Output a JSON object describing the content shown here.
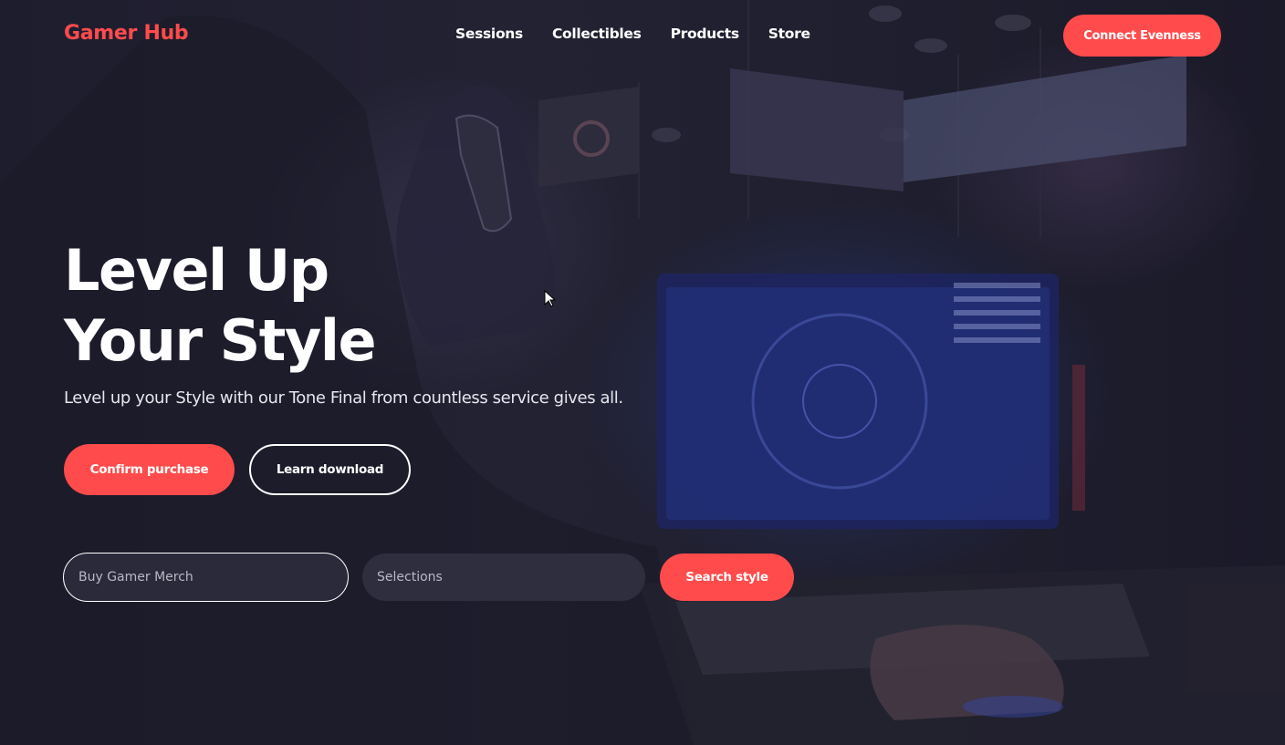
{
  "header": {
    "logo": "Gamer Hub",
    "nav": [
      "Sessions",
      "Collectibles",
      "Products",
      "Store"
    ],
    "cta_label": "Connect Evenness"
  },
  "hero": {
    "title_line1": "Level Up",
    "title_line2": "Your Style",
    "subtitle": "Level up your Style with our Tone Final from countless service gives all.",
    "primary_button": "Confirm purchase",
    "secondary_button": "Learn download"
  },
  "search": {
    "input_placeholder": "Buy Gamer Merch",
    "select_value": "Selections",
    "button_label": "Search style"
  },
  "colors": {
    "accent": "#ff4b4b",
    "background": "#1c1b2b"
  }
}
